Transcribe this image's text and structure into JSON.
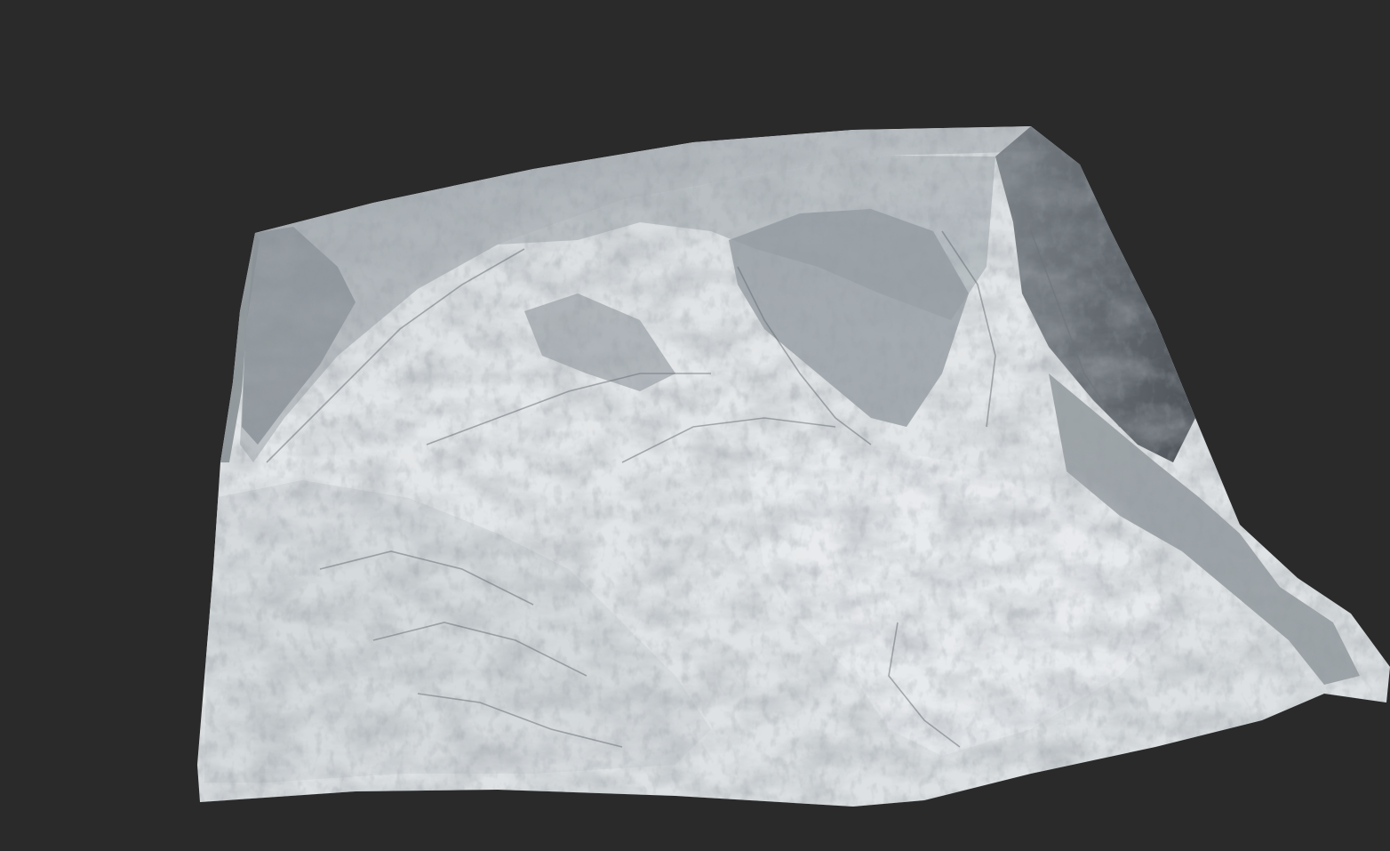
{
  "scene": {
    "subject": "terrain-heightfield-mesh",
    "colors": {
      "background": "#2a2a2a",
      "terrain_light": "#e6e9eb",
      "terrain_mid": "#c7ccd0",
      "terrain_shadow": "#5f666d",
      "terrain_dark": "#3d4349"
    }
  }
}
